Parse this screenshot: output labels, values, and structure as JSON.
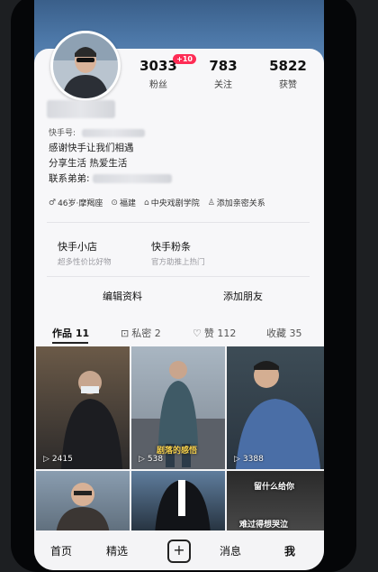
{
  "profile": {
    "stats": [
      {
        "value": "3033",
        "label": "粉丝",
        "badge": "+10"
      },
      {
        "value": "783",
        "label": "关注"
      },
      {
        "value": "5822",
        "label": "获赞"
      }
    ],
    "id_label": "快手号:",
    "bio": [
      "感谢快手让我们相遇",
      "分享生活 热爱生活",
      "联系弟弟:"
    ],
    "tags": [
      {
        "icon": "gender-icon",
        "text": "46岁·摩羯座"
      },
      {
        "icon": "location-pin-icon",
        "text": "福建"
      },
      {
        "icon": "school-icon",
        "text": "中央戏剧学院"
      },
      {
        "icon": "person-add-icon",
        "text": "添加亲密关系"
      }
    ]
  },
  "shops": [
    {
      "title": "快手小店",
      "subtitle": "超多性价比好物"
    },
    {
      "title": "快手粉条",
      "subtitle": "官方助推上热门"
    }
  ],
  "actions": {
    "edit": "编辑资料",
    "add_friend": "添加朋友"
  },
  "tabs": [
    {
      "label": "作品 11"
    },
    {
      "label": "私密 2",
      "icon": "lock-icon"
    },
    {
      "label": "赞 112",
      "icon": "heart-icon"
    },
    {
      "label": "收藏 35"
    }
  ],
  "videos": [
    {
      "plays": "2415",
      "overlay": ""
    },
    {
      "plays": "538",
      "overlay": "剧落的感悟"
    },
    {
      "plays": "3388",
      "overlay": ""
    },
    {
      "plays": "",
      "overlay": ""
    },
    {
      "plays": "",
      "overlay": ""
    },
    {
      "plays": "",
      "overlay": "留什么给你"
    },
    {
      "plays": "",
      "overlay": "难过得想哭泣"
    }
  ],
  "bottom_nav": {
    "home": "首页",
    "featured": "精选",
    "messages": "消息",
    "me": "我"
  },
  "colors": {
    "accent": "#fe2c55",
    "cover": "#4c77a7"
  }
}
